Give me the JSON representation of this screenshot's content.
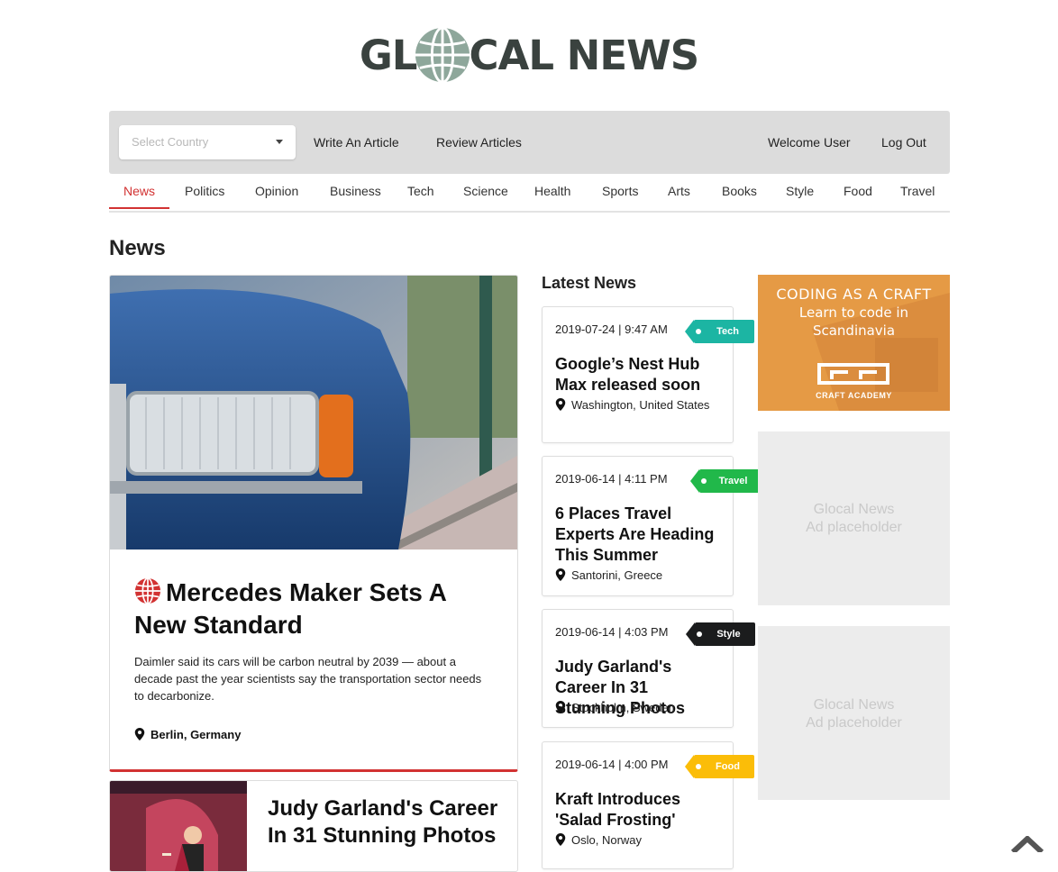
{
  "brand": {
    "before": "GL",
    "after": "CAL NEWS"
  },
  "topbar": {
    "country_placeholder": "Select Country",
    "write_article": "Write An Article",
    "review_articles": "Review Articles",
    "welcome": "Welcome User",
    "logout": "Log Out"
  },
  "categories": [
    "News",
    "Politics",
    "Opinion",
    "Business",
    "Tech",
    "Science",
    "Health",
    "Sports",
    "Arts",
    "Books",
    "Style",
    "Food",
    "Travel"
  ],
  "active_category": "News",
  "section_title": "News",
  "feature": {
    "title": "Mercedes Maker Sets A New Standard",
    "description": "Daimler said its cars will be carbon neutral by 2039 — about a decade past the year scientists say the transportation sector needs to decarbonize.",
    "location": "Berlin, Germany"
  },
  "second_article": {
    "title": "Judy Garland's Career In 31 Stunning Photos"
  },
  "latest": {
    "title": "Latest News",
    "items": [
      {
        "date": "2019-07-24 | 9:47 AM",
        "title": "Google’s Nest Hub Max released soon",
        "location": "Washington, United States",
        "tag": "Tech",
        "tag_color": "#1cb5a3"
      },
      {
        "date": "2019-06-14 | 4:11 PM",
        "title": "6 Places Travel Experts Are Heading This Summer",
        "location": "Santorini, Greece",
        "tag": "Travel",
        "tag_color": "#21b84a"
      },
      {
        "date": "2019-06-14 | 4:03 PM",
        "title": "Judy Garland's Career In 31 Stunning Photos",
        "location": "Stockholm, Sweden",
        "tag": "Style",
        "tag_color": "#1b1c1d"
      },
      {
        "date": "2019-06-14 | 4:00 PM",
        "title": "Kraft Introduces 'Salad Frosting'",
        "location": "Oslo, Norway",
        "tag": "Food",
        "tag_color": "#fbbd08"
      }
    ]
  },
  "ads": {
    "craft": {
      "line1": "CODING AS A CRAFT",
      "line2": "Learn to code in",
      "line3": "Scandinavia",
      "brand": "CRAFT ACADEMY"
    },
    "placeholder_line1": "Glocal News",
    "placeholder_line2": "Ad placeholder"
  },
  "colors": {
    "accent": "#d23232",
    "logo": "#3a423f",
    "globe": "#8ea79b"
  }
}
